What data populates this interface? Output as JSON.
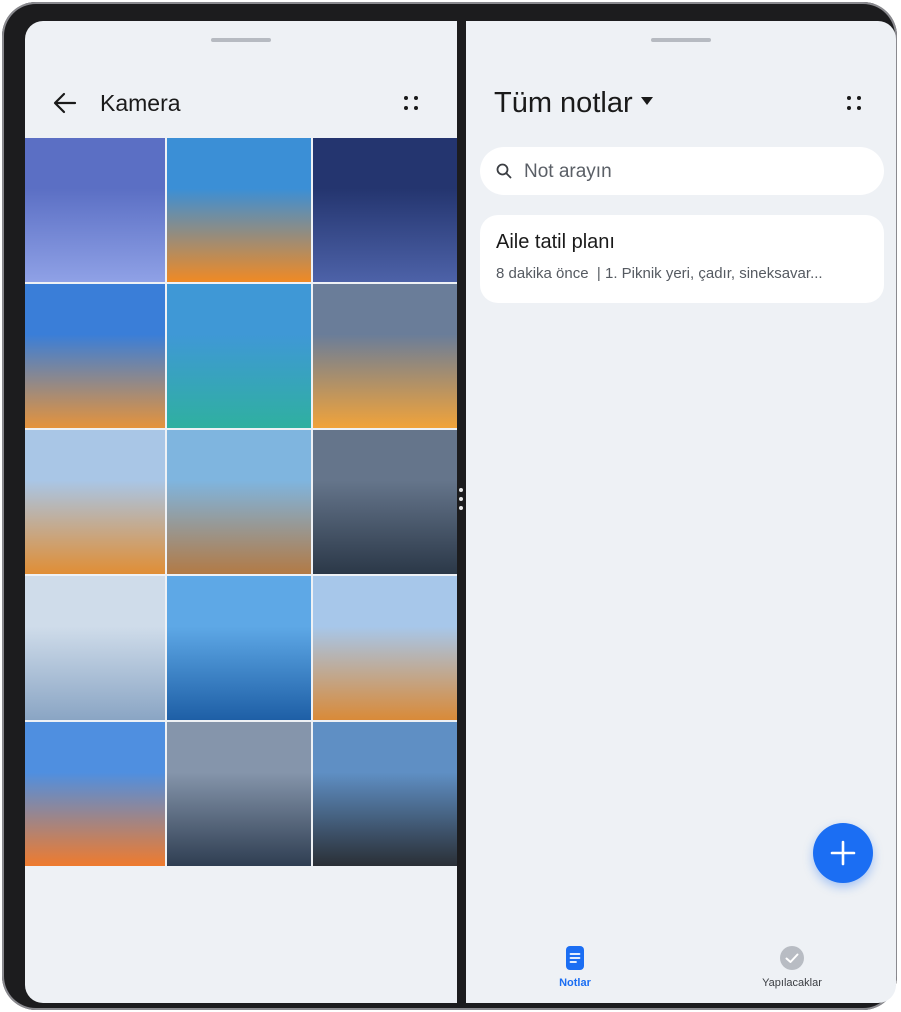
{
  "left_pane": {
    "title": "Kamera",
    "back_icon": "arrow-left-icon",
    "more_icon": "more-dots-icon",
    "photos": [
      {
        "name": "succulent-photo",
        "colors": [
          "#5b6fc4",
          "#8fa1e6"
        ]
      },
      {
        "name": "tent-teddy-photo",
        "colors": [
          "#3b8fd6",
          "#f08a24"
        ]
      },
      {
        "name": "blueberries-photo",
        "colors": [
          "#24356f",
          "#4d62a8"
        ]
      },
      {
        "name": "desert-rock-photo",
        "colors": [
          "#3a7ed8",
          "#e5933c"
        ]
      },
      {
        "name": "canal-houses-photo",
        "colors": [
          "#3f98d6",
          "#2fb0a0"
        ]
      },
      {
        "name": "sunset-clouds-photo",
        "colors": [
          "#6a7d99",
          "#f1a33a"
        ]
      },
      {
        "name": "camel-caravan-photo",
        "colors": [
          "#a9c6e6",
          "#e08e35"
        ]
      },
      {
        "name": "cliff-jump-photo",
        "colors": [
          "#7fb5df",
          "#b27a45"
        ]
      },
      {
        "name": "fishing-net-photo",
        "colors": [
          "#65758b",
          "#2b3848"
        ]
      },
      {
        "name": "dandelion-photo",
        "colors": [
          "#cfdcea",
          "#8aa5c4"
        ]
      },
      {
        "name": "mountain-lake-photo",
        "colors": [
          "#5ea8e6",
          "#1e5fa6"
        ]
      },
      {
        "name": "camel-dunes-photo",
        "colors": [
          "#a7c7ea",
          "#d98a38"
        ]
      },
      {
        "name": "snowboarder-photo",
        "colors": [
          "#4f8fe0",
          "#ef7b2e"
        ]
      },
      {
        "name": "pier-sunset-photo",
        "colors": [
          "#8595ab",
          "#2f3e52"
        ]
      },
      {
        "name": "sea-rock-photo",
        "colors": [
          "#5f8fc4",
          "#2a2f36"
        ]
      }
    ]
  },
  "right_pane": {
    "title": "Tüm notlar",
    "more_icon": "more-dots-icon",
    "search": {
      "placeholder": "Not arayın",
      "icon": "search-icon"
    },
    "note": {
      "title": "Aile tatil planı",
      "time": "8 dakika önce",
      "preview": "1. Piknik yeri, çadır, sineksavar..."
    },
    "fab_icon": "plus-icon",
    "tabs": [
      {
        "label": "Notlar",
        "icon": "note-icon",
        "active": true
      },
      {
        "label": "Yapılacaklar",
        "icon": "check-circle-icon",
        "active": false
      }
    ]
  },
  "colors": {
    "accent": "#1b6ef3",
    "background": "#eef1f5",
    "frame": "#1c1c1e"
  }
}
